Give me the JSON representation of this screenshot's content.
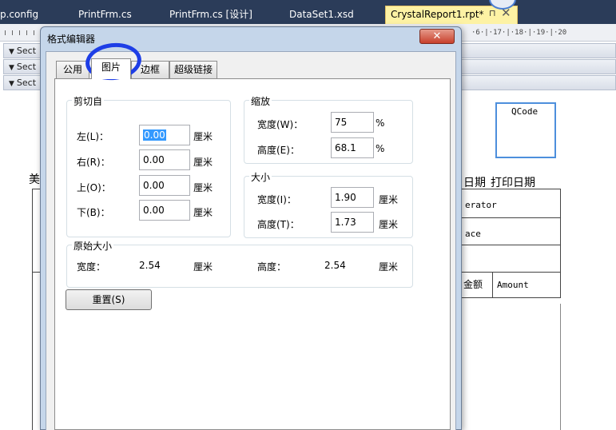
{
  "doc_tabs": [
    "p.config",
    "PrintFrm.cs",
    "PrintFrm.cs [设计]",
    "DataSet1.xsd",
    "CrystalReport1.rpt*"
  ],
  "tab_pin": "⊓",
  "tab_close": "✕",
  "ruler_text": "·6·|·17·|·18·|·19·|·20",
  "sections": [
    "Sect",
    "Sect",
    "Sect"
  ],
  "report": {
    "qcode": "QCode",
    "left_char": "美",
    "print_date_label": "日期",
    "print_date_field": "打印日期",
    "operator": "erator",
    "place": "ace",
    "amount_label": "金额",
    "amount_field": "Amount"
  },
  "dialog": {
    "title": "格式编辑器",
    "close": "✕",
    "tabs": [
      "公用",
      "图片",
      "边框",
      "超级链接"
    ],
    "selected_tab": "图片",
    "crop": {
      "label": "剪切自",
      "rows": [
        {
          "label": "左(L)：",
          "value": "0.00",
          "unit": "厘米"
        },
        {
          "label": "右(R)：",
          "value": "0.00",
          "unit": "厘米"
        },
        {
          "label": "上(O)：",
          "value": "0.00",
          "unit": "厘米"
        },
        {
          "label": "下(B)：",
          "value": "0.00",
          "unit": "厘米"
        }
      ]
    },
    "scale": {
      "label": "缩放",
      "rows": [
        {
          "label": "宽度(W)：",
          "value": "75",
          "unit": "%"
        },
        {
          "label": "高度(E)：",
          "value": "68.1",
          "unit": "%"
        }
      ]
    },
    "size": {
      "label": "大小",
      "rows": [
        {
          "label": "宽度(I)：",
          "value": "1.90",
          "unit": "厘米"
        },
        {
          "label": "高度(T)：",
          "value": "1.73",
          "unit": "厘米"
        }
      ]
    },
    "original": {
      "label": "原始大小",
      "width_label": "宽度：",
      "width_value": "2.54",
      "width_unit": "厘米",
      "height_label": "高度：",
      "height_value": "2.54",
      "height_unit": "厘米"
    },
    "reset_button": "重置(S)"
  }
}
